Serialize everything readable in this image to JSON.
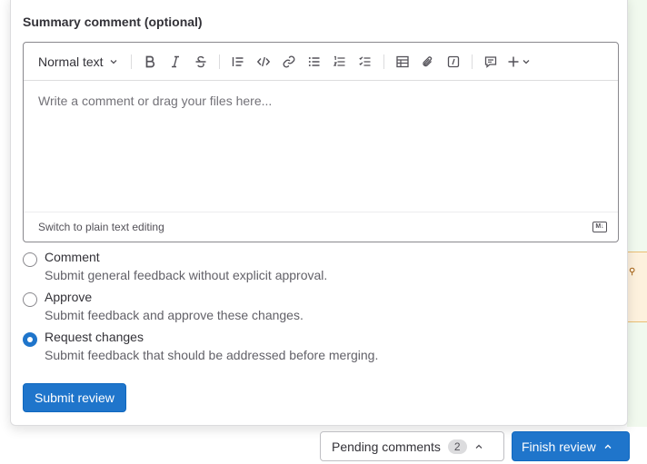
{
  "summary": {
    "title": "Summary comment (optional)"
  },
  "editor": {
    "format_label": "Normal text",
    "placeholder": "Write a comment or drag your files here...",
    "switch_label": "Switch to plain text editing",
    "markdown_badge": "M↓"
  },
  "toolbar_icons": [
    "bold-icon",
    "italic-icon",
    "strikethrough-icon",
    "blockquote-icon",
    "code-icon",
    "link-icon",
    "bullet-list-icon",
    "numbered-list-icon",
    "task-list-icon",
    "table-icon",
    "attach-icon",
    "embed-icon",
    "comment-icon",
    "plus-icon"
  ],
  "options": [
    {
      "label": "Comment",
      "help": "Submit general feedback without explicit approval.",
      "checked": false
    },
    {
      "label": "Approve",
      "help": "Submit feedback and approve these changes.",
      "checked": false
    },
    {
      "label": "Request changes",
      "help": "Submit feedback that should be addressed before merging.",
      "checked": true
    }
  ],
  "submit_label": "Submit review",
  "footer": {
    "pending_label": "Pending comments",
    "pending_count": "2",
    "finish_label": "Finish review"
  },
  "colors": {
    "primary": "#1f75cb",
    "border": "#dcdcde"
  }
}
